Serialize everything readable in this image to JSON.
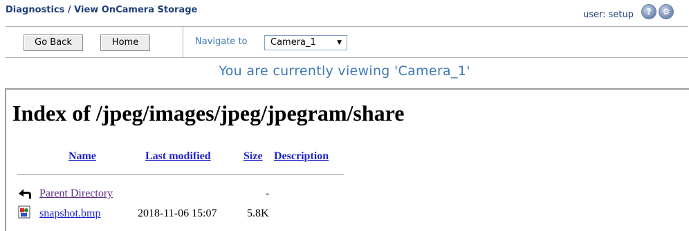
{
  "header": {
    "title": "Diagnostics / View OnCamera Storage",
    "user_label": "user: setup",
    "help_icon": "?",
    "settings_icon": "⚙"
  },
  "toolbar": {
    "go_back_label": "Go Back",
    "home_label": "Home",
    "navigate_label": "Navigate to",
    "camera_selected": "Camera_1",
    "dropdown_arrow": "▼"
  },
  "banner": {
    "text": "You are currently viewing 'Camera_1'"
  },
  "listing": {
    "title": "Index of /jpeg/images/jpeg/jpegram/share",
    "columns": {
      "name": "Name",
      "last_modified": "Last modified",
      "size": "Size",
      "description": "Description"
    },
    "rows": [
      {
        "icon": "back-arrow-icon",
        "name": "Parent Directory",
        "last_modified": "",
        "size": "-",
        "description": ""
      },
      {
        "icon": "image-file-icon",
        "name": "snapshot.bmp",
        "last_modified": "2018-11-06 15:07",
        "size": "5.8K",
        "description": ""
      }
    ]
  }
}
